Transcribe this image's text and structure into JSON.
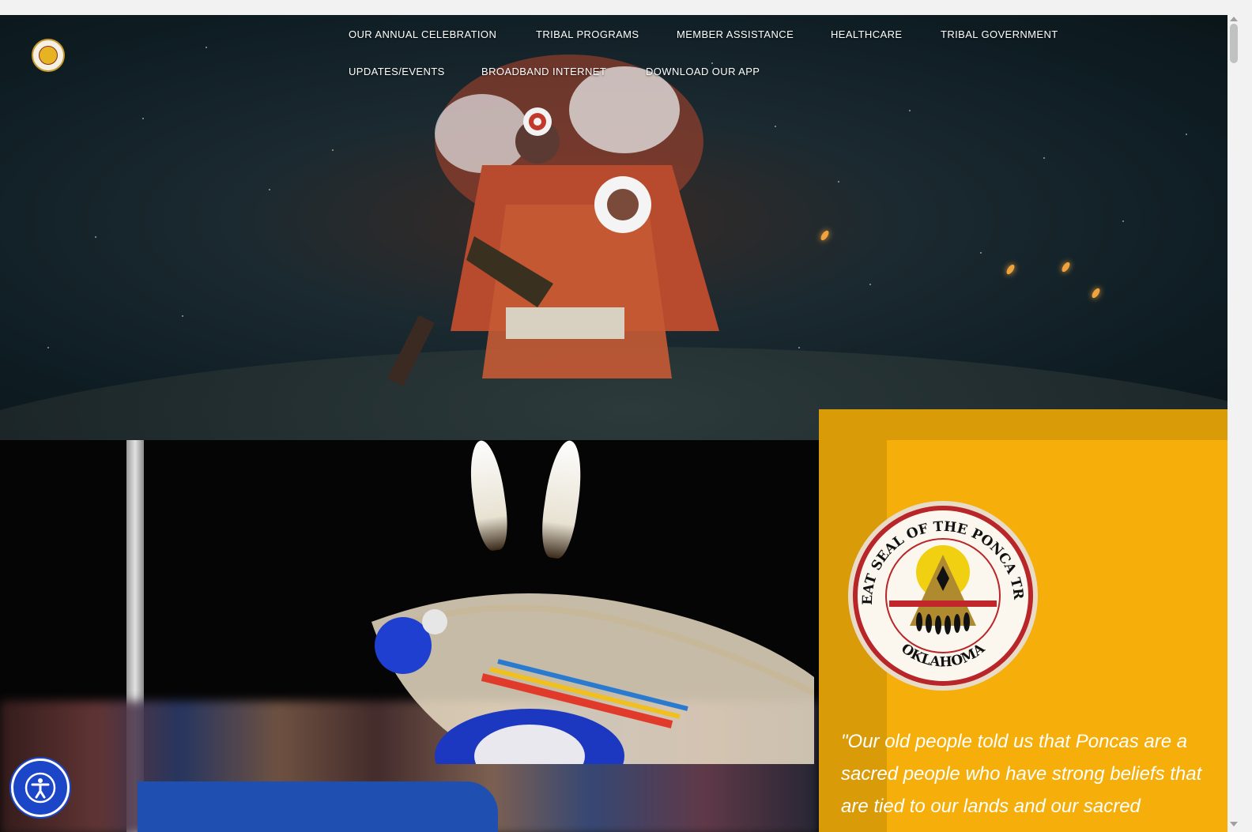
{
  "nav": {
    "items": [
      {
        "label": "OUR ANNUAL CELEBRATION"
      },
      {
        "label": "TRIBAL PROGRAMS"
      },
      {
        "label": "MEMBER ASSISTANCE"
      },
      {
        "label": "HEALTHCARE"
      },
      {
        "label": "TRIBAL GOVERNMENT"
      },
      {
        "label": "UPDATES/EVENTS"
      },
      {
        "label": "BROADBAND INTERNET"
      },
      {
        "label": "DOWNLOAD OUR APP"
      }
    ]
  },
  "seal": {
    "top_text": "GREAT SEAL OF THE PONCA TRIBE",
    "bottom_text": "OKLAHOMA"
  },
  "quote": {
    "text": "\"Our old people told us that Poncas are a sacred people who have strong beliefs that are tied to our lands and our sacred"
  },
  "colors": {
    "panel": "#f5ae0a",
    "panel_dark": "#d99b08",
    "accessibility": "#1c46c8"
  },
  "icons": {
    "accessibility": "accessibility-icon",
    "logo": "tribe-logo-icon"
  }
}
